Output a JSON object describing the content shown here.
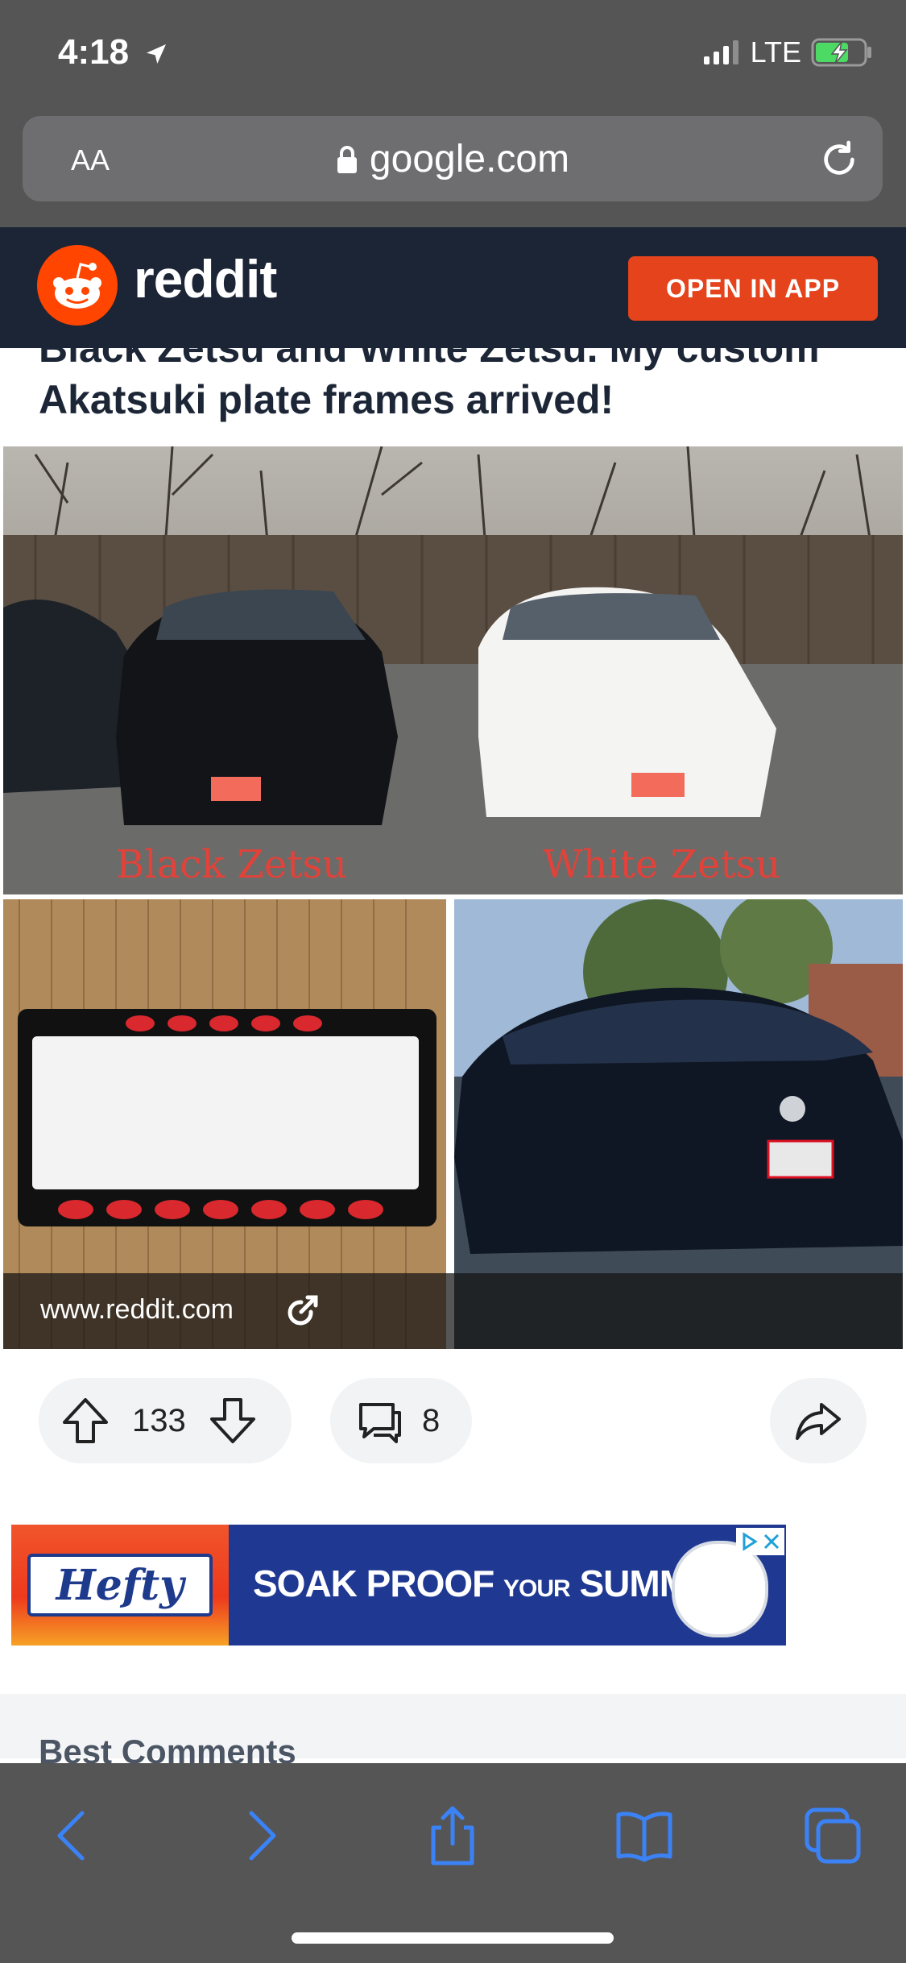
{
  "status_bar": {
    "time": "4:18",
    "network": "LTE"
  },
  "browser": {
    "text_size_label": "AA",
    "url": "google.com"
  },
  "reddit_header": {
    "wordmark": "reddit",
    "open_in_app_label": "OPEN IN APP"
  },
  "post": {
    "title": "Black Zetsu and White Zetsu. My custom Akatsuki plate frames arrived!",
    "image_caption_left": "Black Zetsu",
    "image_caption_right": "White Zetsu",
    "link_domain": "www.reddit.com",
    "vote_count": "133",
    "comment_count": "8"
  },
  "ad": {
    "brand": "Hefty",
    "headline_part1": "SOAK PROOF",
    "headline_part2": "YOUR",
    "headline_part3": "SUMMER"
  },
  "comments": {
    "section_heading": "Best Comments"
  },
  "colors": {
    "reddit_orange": "#e4431b",
    "header_navy": "#1b2535",
    "safari_chrome": "#555556",
    "toolbar_blue": "#3b82f6"
  }
}
